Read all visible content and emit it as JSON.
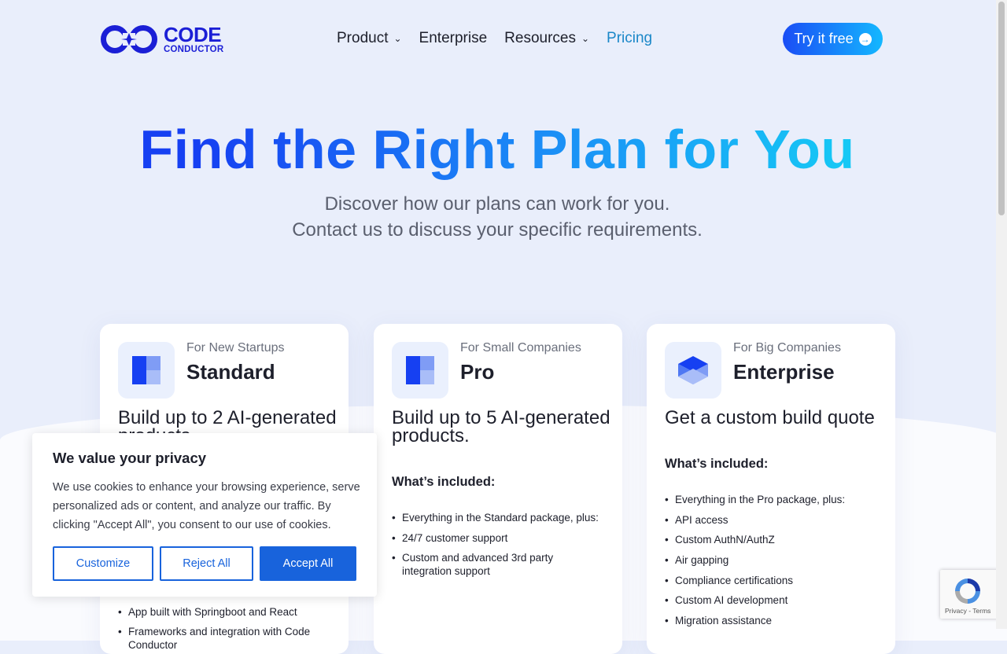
{
  "header": {
    "logo_line1": "CODE",
    "logo_line2": "CONDUCTOR",
    "nav": [
      {
        "label": "Product",
        "dropdown": true
      },
      {
        "label": "Enterprise",
        "dropdown": false
      },
      {
        "label": "Resources",
        "dropdown": true
      },
      {
        "label": "Pricing",
        "dropdown": false,
        "active": true
      }
    ],
    "cta": "Try it free"
  },
  "hero": {
    "title": "Find the Right Plan for You",
    "subtitle_line1": "Discover how our plans can work for you.",
    "subtitle_line2": "Contact us to discuss your specific requirements."
  },
  "plans": [
    {
      "for": "For New Startups",
      "name": "Standard",
      "headline": "Build up to 2 AI-generated products.",
      "features_visible": [
        "App built with Springboot and React",
        "Frameworks and integration with Code Conductor"
      ]
    },
    {
      "for": "For Small Companies",
      "name": "Pro",
      "headline": "Build up to 5 AI-generated products.",
      "included_title": "What’s included:",
      "features": [
        "Everything in the Standard package, plus:",
        "24/7 customer support",
        "Custom and advanced 3rd party integration support"
      ]
    },
    {
      "for": "For Big Companies",
      "name": "Enterprise",
      "headline": "Get a custom build quote",
      "included_title": "What’s included:",
      "features": [
        "Everything in the Pro package, plus:",
        "API access",
        "Custom AuthN/AuthZ",
        "Air gapping",
        "Compliance certifications",
        "Custom AI development",
        "Migration assistance"
      ]
    }
  ],
  "cookie": {
    "title": "We value your privacy",
    "text": "We use cookies to enhance your browsing experience, serve personalized ads or content, and analyze our traffic. By clicking \"Accept All\", you consent to our use of cookies.",
    "customize": "Customize",
    "reject": "Reject All",
    "accept": "Accept All"
  },
  "recaptcha": {
    "links": "Privacy - Terms"
  },
  "colors": {
    "brand": "#1b1fd6",
    "accent": "#1863dc",
    "active_nav": "#1a87c8"
  }
}
